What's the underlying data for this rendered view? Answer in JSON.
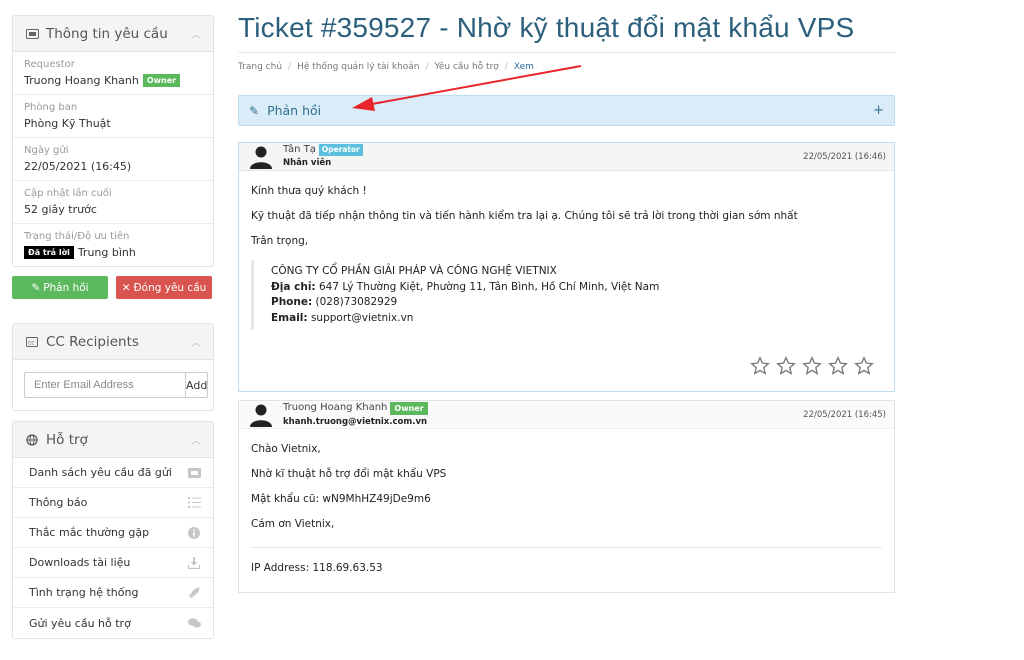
{
  "ticket_info": {
    "title": "Thông tin yêu cầu",
    "requestor_label": "Requestor",
    "requestor_value": "Truong Hoang Khanh",
    "owner_badge": "Owner",
    "department_label": "Phòng ban",
    "department_value": "Phòng Kỹ Thuật",
    "date_sent_label": "Ngày gửi",
    "date_sent_value": "22/05/2021 (16:45)",
    "last_update_label": "Cập nhật lần cuối",
    "last_update_value": "52 giây trước",
    "status_label": "Trạng thái/Độ ưu tiên",
    "status_badge": "Đã trả lời",
    "priority_value": "Trung bình",
    "reply_button": "Phản hồi",
    "close_button": "Đóng yêu cầu"
  },
  "cc": {
    "title": "CC Recipients",
    "placeholder": "Enter Email Address",
    "add_label": "Add"
  },
  "support": {
    "title": "Hỗ trợ",
    "items": [
      {
        "label": "Danh sách yêu cầu đã gửi",
        "icon": "ticket-icon"
      },
      {
        "label": "Thông báo",
        "icon": "list-icon"
      },
      {
        "label": "Thắc mắc thường gặp",
        "icon": "info-icon"
      },
      {
        "label": "Downloads tài liệu",
        "icon": "download-icon"
      },
      {
        "label": "Tình trạng hệ thống",
        "icon": "rocket-icon"
      },
      {
        "label": "Gửi yêu cầu hỗ trợ",
        "icon": "comments-icon"
      }
    ]
  },
  "main": {
    "title": "Ticket #359527 - Nhờ kỹ thuật đổi mật khẩu VPS",
    "breadcrumb": [
      "Trang chủ",
      "Hệ thống quản lý tài khoản",
      "Yêu cầu hỗ trợ",
      "Xem"
    ],
    "reply_bar_label": "Phản hồi",
    "reply_bar_plus": "+"
  },
  "messages": [
    {
      "name": "Tân Tạ",
      "badge": "Operator",
      "role": "Nhân viên",
      "date": "22/05/2021 (16:46)",
      "lines": [
        "Kính thưa quý khách !",
        "Kỹ thuật đã tiếp nhận thông tin và tiến hành kiểm tra lại ạ. Chúng tôi sẽ trả lời trong thời gian sớm nhất",
        "Trân trọng,"
      ],
      "signature": {
        "company": "CÔNG TY CỔ PHẦN GIẢI PHÁP VÀ CÔNG NGHỆ VIETNIX",
        "address_label": "Địa chỉ:",
        "address": "647 Lý Thường Kiệt, Phường 11, Tân Bình, Hồ Chí Minh, Việt Nam",
        "phone_label": "Phone:",
        "phone": "(028)73082929",
        "email_label": "Email:",
        "email": "support@vietnix.vn"
      },
      "rating": 0
    },
    {
      "name": "Truong Hoang Khanh",
      "badge": "Owner",
      "email": "khanh.truong@vietnix.com.vn",
      "date": "22/05/2021 (16:45)",
      "lines": [
        "Chào Vietnix,",
        "Nhờ kĩ thuật hỗ trợ đổi mật khẩu VPS",
        "Mật khẩu cũ: wN9MhHZ49jDe9m6",
        "Cám ơn Vietnix,"
      ],
      "ip": "IP Address: 118.69.63.53"
    }
  ],
  "colors": {
    "title": "#2c5f7c",
    "green": "#5cb85c",
    "red": "#d9534f",
    "info": "#5bc0de",
    "annotation_arrow": "#e8252a"
  }
}
